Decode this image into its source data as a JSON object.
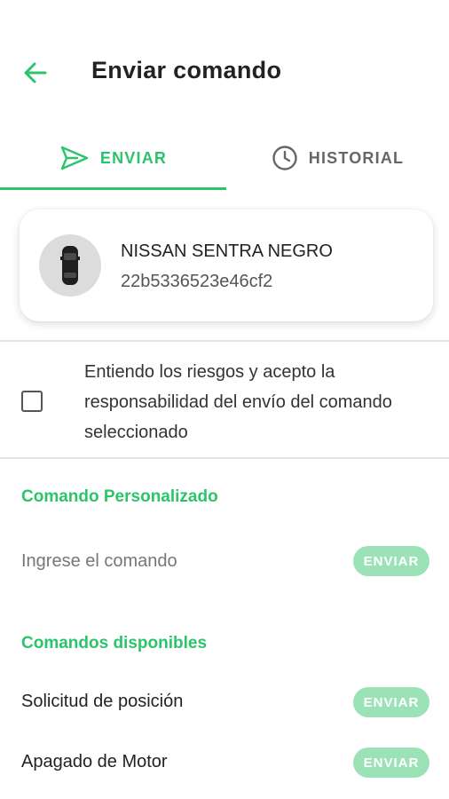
{
  "header": {
    "title": "Enviar comando",
    "back_icon": "arrow-left-icon"
  },
  "tabs": [
    {
      "label": "ENVIAR",
      "icon": "send-icon",
      "active": true
    },
    {
      "label": "HISTORIAL",
      "icon": "clock-icon",
      "active": false
    }
  ],
  "vehicle": {
    "name": "NISSAN SENTRA NEGRO",
    "id": "22b5336523e46cf2",
    "icon": "car-icon"
  },
  "agreement": {
    "text": "Entiendo los riesgos y acepto la responsabilidad del envío del comando seleccionado",
    "checked": false
  },
  "custom_command": {
    "section_title": "Comando Personalizado",
    "input_placeholder": "Ingrese el comando",
    "input_value": "",
    "send_label": "ENVIAR"
  },
  "available_commands": {
    "section_title": "Comandos disponibles",
    "items": [
      {
        "label": "Solicitud de posición",
        "send_label": "ENVIAR"
      },
      {
        "label": "Apagado de Motor",
        "send_label": "ENVIAR"
      }
    ]
  },
  "colors": {
    "accent": "#2cc46b",
    "button_disabled": "#9be3b7",
    "text": "#222222"
  }
}
